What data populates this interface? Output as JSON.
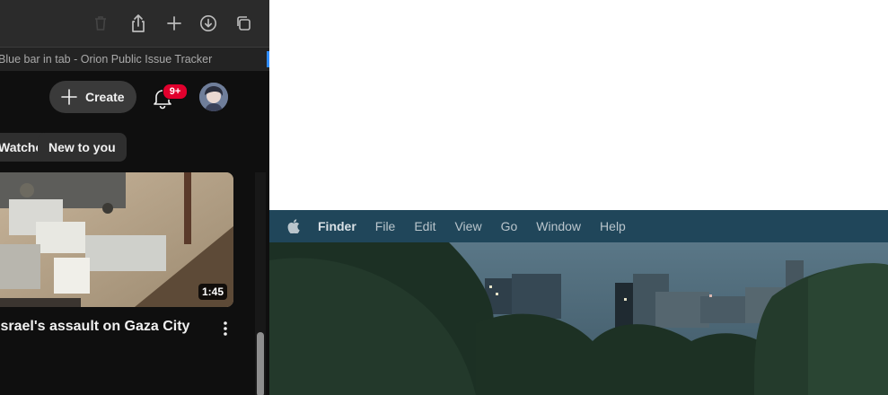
{
  "browser": {
    "tab_title": "Blue bar in tab - Orion Public Issue Tracker",
    "toolbar_icons": [
      "trash-icon",
      "share-icon",
      "new-tab-plus-icon",
      "download-icon",
      "tabs-overview-icon"
    ],
    "accent_color": "#2f8cff"
  },
  "youtube": {
    "create_label": "Create",
    "notifications_badge": "9+",
    "chips": [
      "Watched",
      "New to you"
    ],
    "video": {
      "title": "Israel's assault on Gaza City",
      "duration": "1:45"
    },
    "badge_color": "#e1002d"
  },
  "desktop": {
    "app_name": "Finder",
    "menu": [
      "File",
      "Edit",
      "View",
      "Go",
      "Window",
      "Help"
    ],
    "menubar_color": "#20465a"
  }
}
